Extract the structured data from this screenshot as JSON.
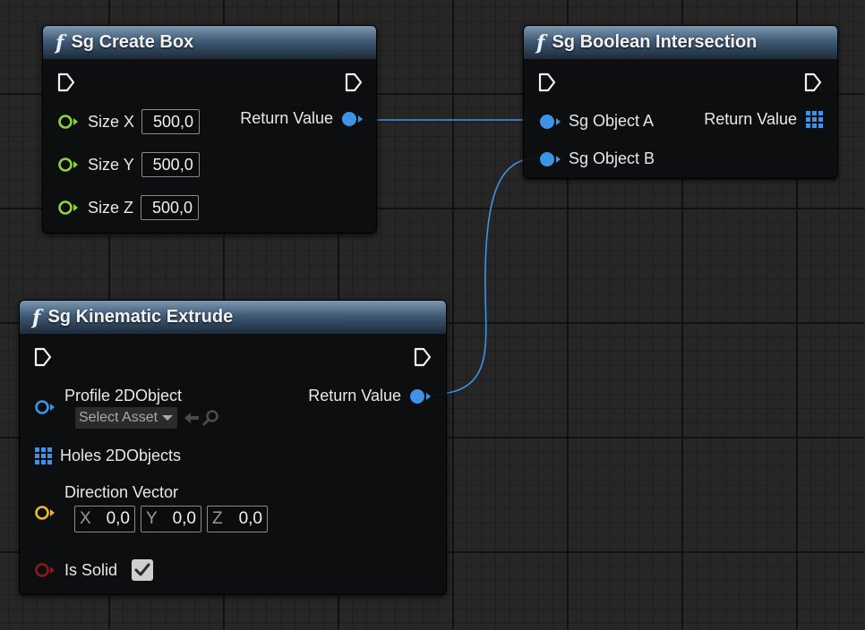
{
  "nodes": {
    "create_box": {
      "title": "Sg Create Box",
      "fx_glyph": "f",
      "size_x_label": "Size X",
      "size_x_value": "500,0",
      "size_y_label": "Size Y",
      "size_y_value": "500,0",
      "size_z_label": "Size Z",
      "size_z_value": "500,0",
      "return_label": "Return Value"
    },
    "boolean_intersection": {
      "title": "Sg Boolean Intersection",
      "fx_glyph": "f",
      "object_a_label": "Sg Object A",
      "object_b_label": "Sg Object B",
      "return_label": "Return Value"
    },
    "kinematic_extrude": {
      "title": "Sg Kinematic Extrude",
      "fx_glyph": "f",
      "profile_label": "Profile 2DObject",
      "select_asset_label": "Select Asset",
      "holes_label": "Holes 2DObjects",
      "direction_label": "Direction Vector",
      "axis_x_letter": "X",
      "axis_x_value": "0,0",
      "axis_y_letter": "Y",
      "axis_y_value": "0,0",
      "axis_z_letter": "Z",
      "axis_z_value": "0,0",
      "is_solid_label": "Is Solid",
      "is_solid_checked": true,
      "return_label": "Return Value"
    }
  },
  "icons": {
    "exec_pin": "exec-arrow-icon",
    "object_pin": "object-pin-icon",
    "array_pin": "array-grid-icon",
    "float_pin": "float-pin-icon",
    "vector_pin": "vector-pin-icon",
    "bool_pin": "bool-pin-icon",
    "function": "function-icon",
    "dropdown": "chevron-down-icon",
    "use_selected": "arrow-left-icon",
    "browse": "search-icon",
    "check": "checkmark-icon"
  },
  "colors": {
    "canvas_bg": "#262626",
    "header_blue": "#3f5b77",
    "object_pin": "#3f93e6",
    "float_pin": "#8fd140",
    "vector_pin": "#e7b92f",
    "bool_pin": "#8a1a1a",
    "wire": "#3f93e6"
  }
}
